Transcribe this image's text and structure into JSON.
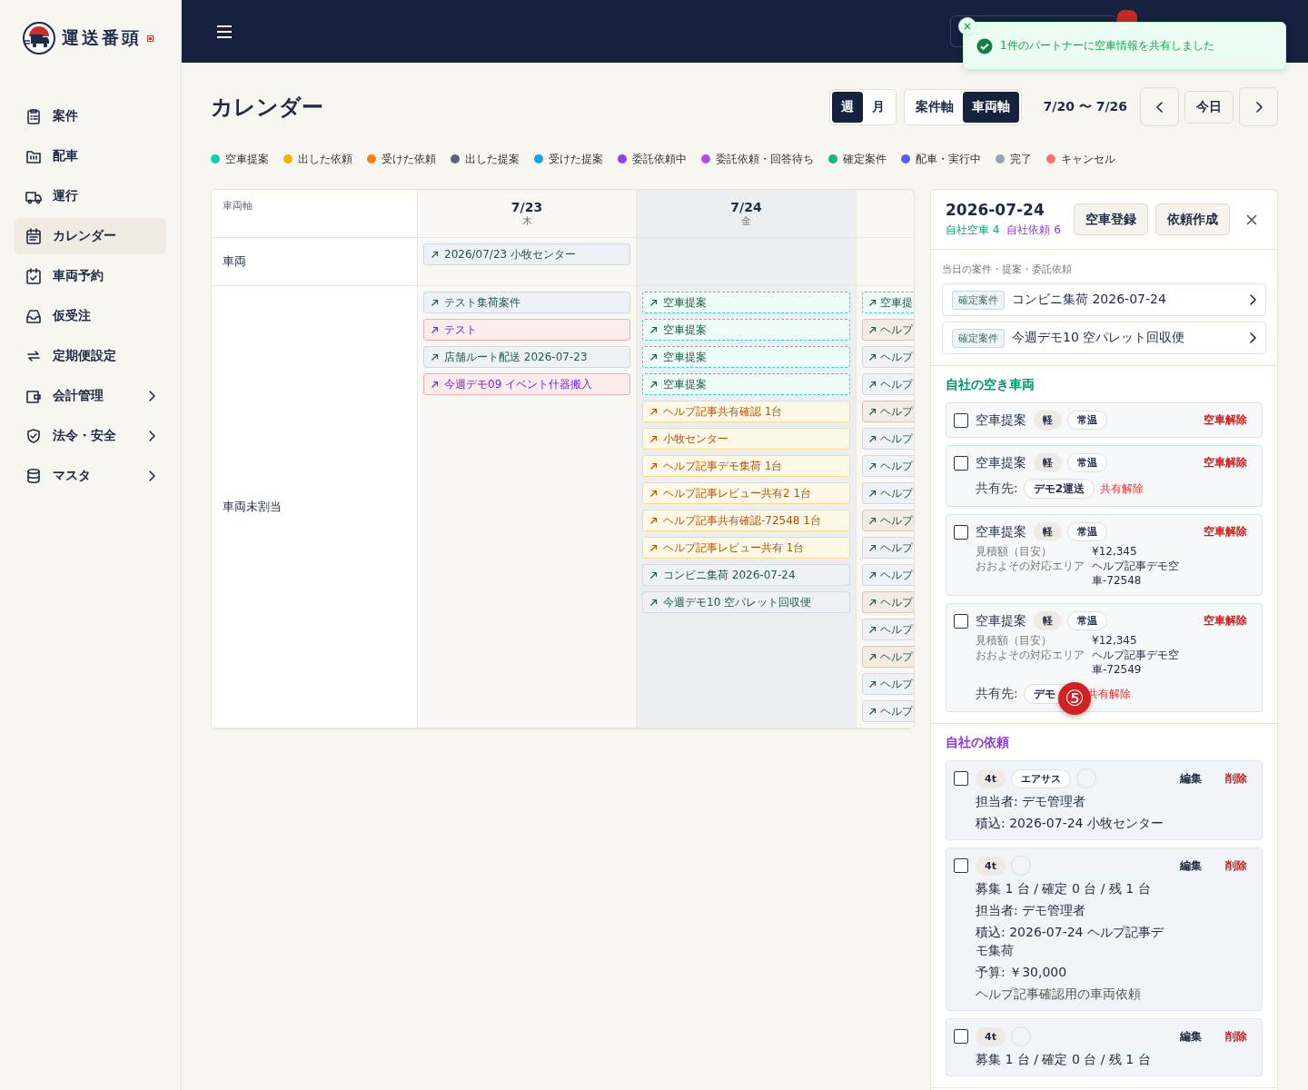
{
  "brand": {
    "name": "運送番頭"
  },
  "sidebar": {
    "items": [
      {
        "label": "案件",
        "selected": false,
        "expandable": false
      },
      {
        "label": "配車",
        "selected": false,
        "expandable": false
      },
      {
        "label": "運行",
        "selected": false,
        "expandable": false
      },
      {
        "label": "カレンダー",
        "selected": true,
        "expandable": false
      },
      {
        "label": "車両予約",
        "selected": false,
        "expandable": false
      },
      {
        "label": "仮受注",
        "selected": false,
        "expandable": false
      },
      {
        "label": "定期便設定",
        "selected": false,
        "expandable": false
      },
      {
        "label": "会計管理",
        "selected": false,
        "expandable": true
      },
      {
        "label": "法令・安全",
        "selected": false,
        "expandable": true
      },
      {
        "label": "マスタ",
        "selected": false,
        "expandable": true
      }
    ]
  },
  "toast": {
    "message": "1件のパートナーに空車情報を共有しました"
  },
  "page": {
    "title": "カレンダー"
  },
  "view_toggle": [
    {
      "label": "週",
      "selected": true
    },
    {
      "label": "月",
      "selected": false
    }
  ],
  "axis_toggle": [
    {
      "label": "案件軸",
      "selected": false
    },
    {
      "label": "車両軸",
      "selected": true
    }
  ],
  "date_range": "7/20 〜 7/26",
  "today_button": "今日",
  "legend": [
    {
      "label": "空車提案",
      "color": "#10cfb0"
    },
    {
      "label": "出した依頼",
      "color": "#f5b400"
    },
    {
      "label": "受けた依頼",
      "color": "#f97f0f"
    },
    {
      "label": "出した提案",
      "color": "#5b6478"
    },
    {
      "label": "受けた提案",
      "color": "#0ea5e9"
    },
    {
      "label": "委託依頼中",
      "color": "#8b44f0"
    },
    {
      "label": "委託依頼・回答待ち",
      "color": "#b44cf5"
    },
    {
      "label": "確定案件",
      "color": "#10b981"
    },
    {
      "label": "配車・実行中",
      "color": "#5b5cf6"
    },
    {
      "label": "完了",
      "color": "#94a3b8"
    },
    {
      "label": "キャンセル",
      "color": "#f87171"
    }
  ],
  "calendar": {
    "corner_label": "車両軸",
    "days": [
      {
        "date": "7/23",
        "weekday": "木",
        "selected": false
      },
      {
        "date": "7/24",
        "weekday": "金",
        "selected": true
      },
      {
        "selected": false
      }
    ],
    "rows": [
      {
        "label": "車両",
        "cells": [
          [
            {
              "title": "2026/07/23 小牧センター",
              "kind": "case"
            }
          ],
          [],
          []
        ]
      },
      {
        "label": "車両未割当",
        "cells": [
          [
            {
              "title": "テスト集荷案件",
              "kind": "case"
            },
            {
              "title": "テスト",
              "kind": "consign"
            },
            {
              "title": "店舗ルート配送 2026-07-23",
              "kind": "case"
            },
            {
              "title": "今週デモ09 イベント什器搬入",
              "kind": "consign"
            }
          ],
          [
            {
              "title": "空車提案",
              "kind": "vacancy"
            },
            {
              "title": "空車提案",
              "kind": "vacancy"
            },
            {
              "title": "空車提案",
              "kind": "vacancy"
            },
            {
              "title": "空車提案",
              "kind": "vacancy"
            },
            {
              "title": "ヘルプ記事共有確認 1台",
              "kind": "request"
            },
            {
              "title": "小牧センター",
              "kind": "request"
            },
            {
              "title": "ヘルプ記事デモ集荷 1台",
              "kind": "request"
            },
            {
              "title": "ヘルプ記事レビュー共有2 1台",
              "kind": "request"
            },
            {
              "title": "ヘルプ記事共有確認-72548 1台",
              "kind": "request"
            },
            {
              "title": "ヘルプ記事レビュー共有 1台",
              "kind": "request"
            },
            {
              "title": "コンビニ集荷 2026-07-24",
              "kind": "case"
            },
            {
              "title": "今週デモ10 空パレット回収便",
              "kind": "case"
            }
          ],
          [
            {
              "title": "空車提",
              "kind": "vacancy"
            },
            {
              "title": "ヘルプ",
              "kind": "proposal"
            },
            {
              "title": "ヘルプ",
              "kind": "case"
            },
            {
              "title": "ヘルプ",
              "kind": "case"
            },
            {
              "title": "ヘルプ",
              "kind": "proposal"
            },
            {
              "title": "ヘルプ",
              "kind": "case"
            },
            {
              "title": "ヘルプ",
              "kind": "case"
            },
            {
              "title": "ヘルプ",
              "kind": "case"
            },
            {
              "title": "ヘルプ",
              "kind": "proposal"
            },
            {
              "title": "ヘルプ",
              "kind": "case"
            },
            {
              "title": "ヘルプ",
              "kind": "case"
            },
            {
              "title": "ヘルプ",
              "kind": "proposal"
            },
            {
              "title": "ヘルプ",
              "kind": "case"
            },
            {
              "title": "ヘルプ",
              "kind": "proposal"
            },
            {
              "title": "ヘルプ",
              "kind": "case"
            },
            {
              "title": "ヘルプ",
              "kind": "case"
            }
          ]
        ]
      }
    ]
  },
  "detail_panel": {
    "date": "2026-07-24",
    "stats": [
      {
        "text": "自社空車 4",
        "kind": "vacancy"
      },
      {
        "text": "自社依頼 6",
        "kind": "request"
      }
    ],
    "buttons": [
      "空車登録",
      "依頼作成"
    ],
    "day_items_heading": "当日の案件・提案・委託依頼",
    "day_items": [
      {
        "tag": "確定案件",
        "title": "コンビニ集荷 2026-07-24"
      },
      {
        "tag": "確定案件",
        "title": "今週デモ10 空パレット回収便"
      }
    ],
    "vacancy_heading": "自社の空き車両",
    "vacancies": [
      {
        "checked": false,
        "title": "空車提案",
        "chips": [
          {
            "text": "軽",
            "kind": "filled"
          },
          {
            "text": "常温",
            "kind": "outline"
          }
        ],
        "action": "空車解除"
      },
      {
        "checked": false,
        "title": "空車提案",
        "chips": [
          {
            "text": "軽",
            "kind": "filled"
          },
          {
            "text": "常温",
            "kind": "outline"
          }
        ],
        "action": "空車解除",
        "share": {
          "label": "共有先:",
          "partner": "デモ2運送",
          "action": "共有解除"
        }
      },
      {
        "checked": false,
        "title": "空車提案",
        "chips": [
          {
            "text": "軽",
            "kind": "filled"
          },
          {
            "text": "常温",
            "kind": "outline"
          }
        ],
        "action": "空車解除",
        "details": [
          {
            "label": "見積額（目安）",
            "value": "¥12,345"
          },
          {
            "label": "おおよその対応エリア",
            "value": "ヘルプ記事デモ空車-72548"
          }
        ]
      },
      {
        "checked": false,
        "title": "空車提案",
        "chips": [
          {
            "text": "軽",
            "kind": "filled"
          },
          {
            "text": "常温",
            "kind": "outline"
          }
        ],
        "action": "空車解除",
        "details": [
          {
            "label": "見積額（目安）",
            "value": "¥12,345"
          },
          {
            "label": "おおよその対応エリア",
            "value": "ヘルプ記事デモ空車-72549"
          }
        ],
        "share": {
          "label": "共有先:",
          "partner": "デモ",
          "action": "共有解除"
        }
      }
    ],
    "request_heading": "自社の依頼",
    "requests": [
      {
        "checked": false,
        "chips": [
          {
            "text": "4t",
            "kind": "filled"
          },
          {
            "text": "エアサス",
            "kind": "outline"
          },
          {
            "kind": "blank"
          }
        ],
        "edit": "編集",
        "delete": "削除",
        "lines": [
          {
            "text": "担当者: デモ管理者",
            "kind": "normal"
          },
          {
            "text": "積込: 2026-07-24 小牧センター",
            "kind": "normal"
          }
        ]
      },
      {
        "checked": false,
        "chips": [
          {
            "text": "4t",
            "kind": "filled"
          },
          {
            "kind": "blank"
          }
        ],
        "edit": "編集",
        "delete": "削除",
        "lines": [
          {
            "text": "募集 1 台 / 確定 0 台 / 残 1 台",
            "kind": "normal"
          },
          {
            "text": "担当者: デモ管理者",
            "kind": "normal"
          },
          {
            "text": "積込: 2026-07-24 ヘルプ記事デモ集荷",
            "kind": "normal"
          },
          {
            "text": "予算: ￥30,000",
            "kind": "normal"
          },
          {
            "text": "ヘルプ記事確認用の車両依頼",
            "kind": "note"
          }
        ]
      },
      {
        "checked": false,
        "chips": [
          {
            "text": "4t",
            "kind": "filled"
          },
          {
            "kind": "blank"
          }
        ],
        "edit": "編集",
        "delete": "削除",
        "lines": [
          {
            "text": "募集 1 台 / 確定 0 台 / 残 1 台",
            "kind": "normal"
          }
        ]
      }
    ]
  },
  "floating_badge": "⑤"
}
